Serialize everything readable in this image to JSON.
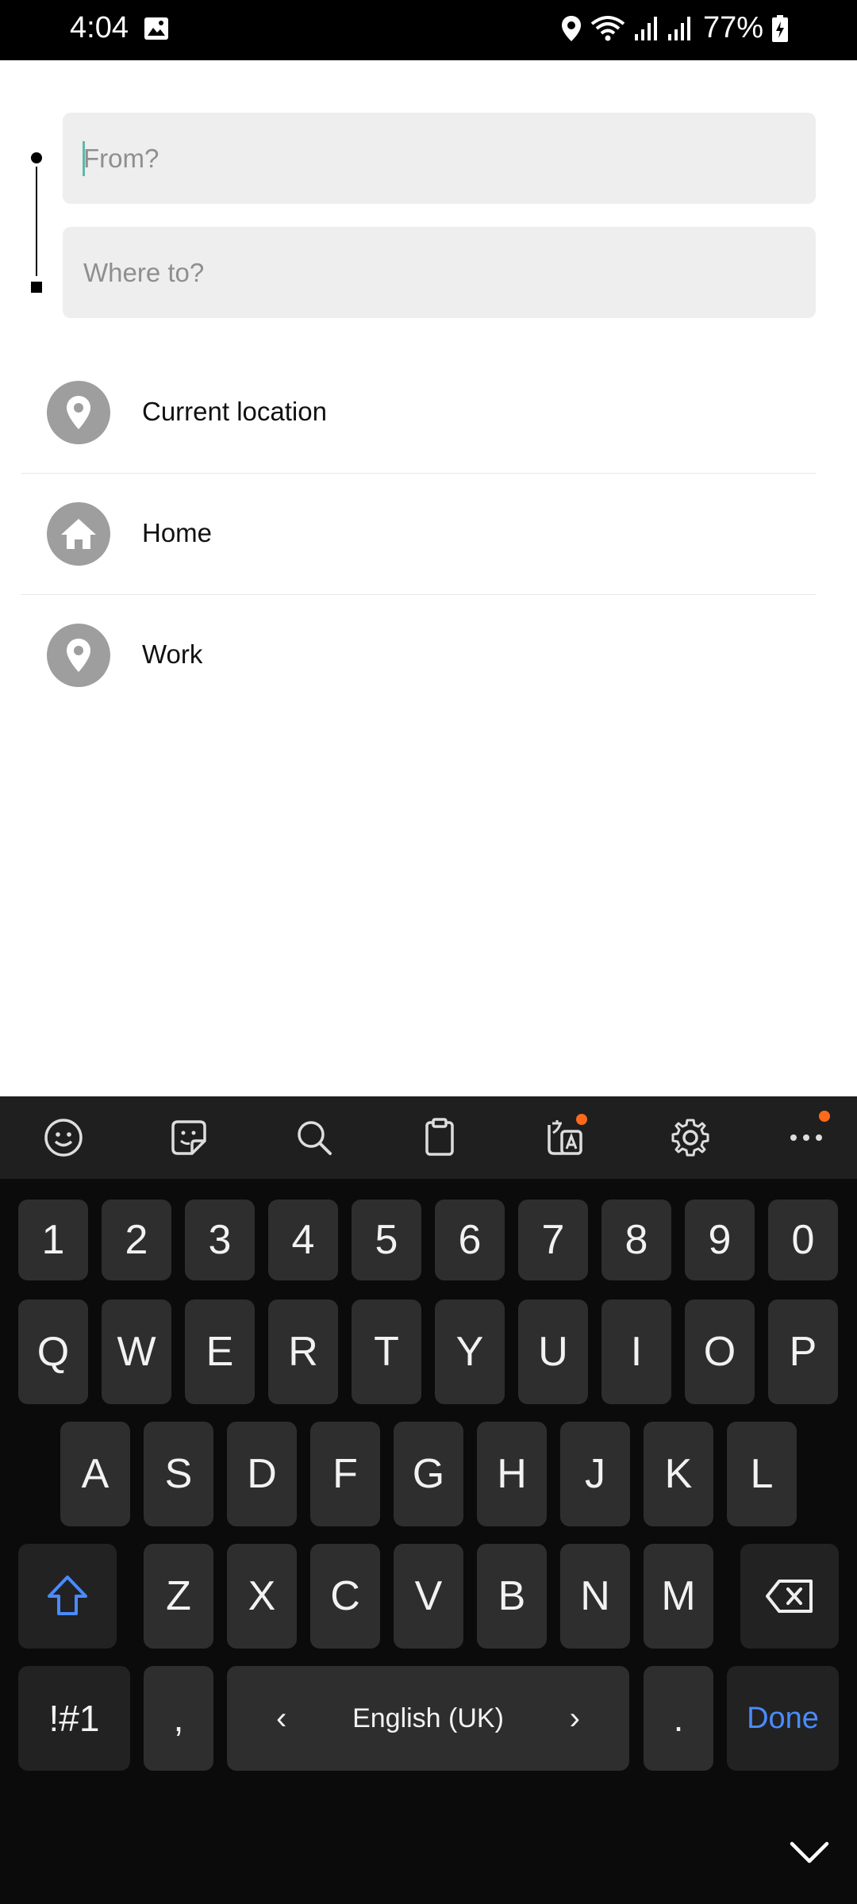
{
  "status_bar": {
    "time": "4:04",
    "battery": "77%"
  },
  "route": {
    "from_placeholder": "From?",
    "to_placeholder": "Where to?"
  },
  "suggestions": [
    {
      "label": "Current location",
      "icon": "location-pin-icon"
    },
    {
      "label": "Home",
      "icon": "home-icon"
    },
    {
      "label": "Work",
      "icon": "location-pin-icon"
    }
  ],
  "keyboard": {
    "toolbar": [
      "emoji-icon",
      "sticker-icon",
      "search-icon",
      "clipboard-icon",
      "translate-icon",
      "settings-icon",
      "more-icon"
    ],
    "number_row": [
      "1",
      "2",
      "3",
      "4",
      "5",
      "6",
      "7",
      "8",
      "9",
      "0"
    ],
    "row1": [
      "Q",
      "W",
      "E",
      "R",
      "T",
      "Y",
      "U",
      "I",
      "O",
      "P"
    ],
    "row2": [
      "A",
      "S",
      "D",
      "F",
      "G",
      "H",
      "J",
      "K",
      "L"
    ],
    "row3": [
      "Z",
      "X",
      "C",
      "V",
      "B",
      "N",
      "M"
    ],
    "symbols_label": "!#1",
    "comma_label": ",",
    "space_label": "English (UK)",
    "space_left": "‹",
    "space_right": "›",
    "period_label": ".",
    "done_label": "Done"
  },
  "colors": {
    "accent": "#4a8bff",
    "notification_dot": "#ff6a1a",
    "field_bg": "#eeeeee",
    "icon_circle": "#9e9e9e"
  }
}
